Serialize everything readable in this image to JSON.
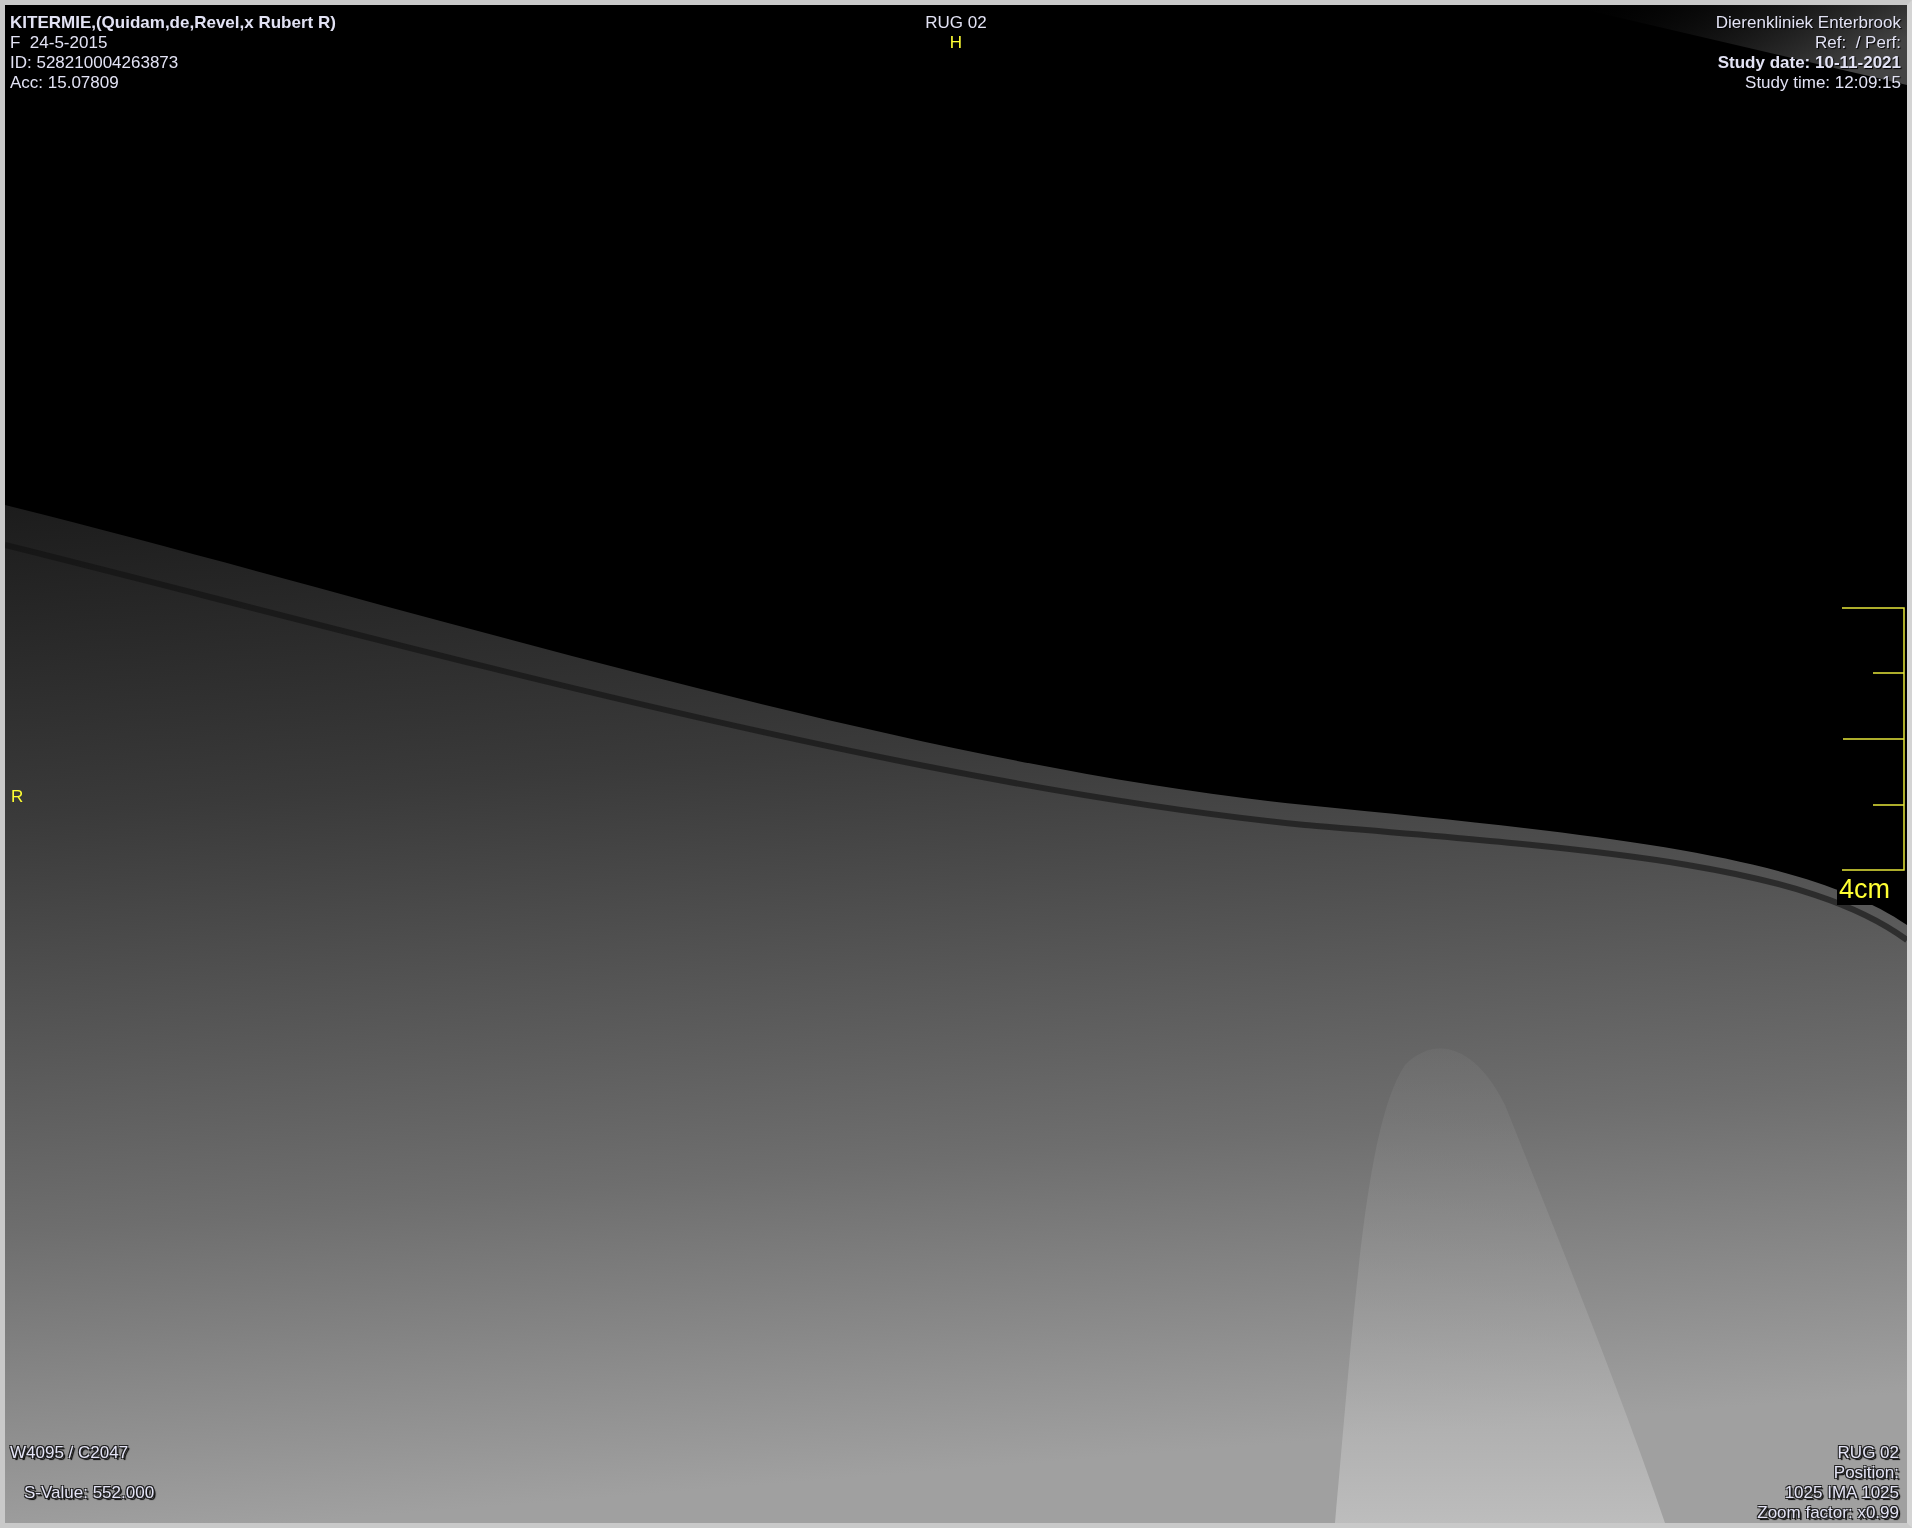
{
  "top_left": {
    "patient_name": "KITERMIE,(Quidam,de,Revel,x Rubert R)",
    "lines": [
      "F  24-5-2015",
      "ID: 528210004263873",
      "Acc: 15.07809"
    ]
  },
  "top_center": {
    "series": "RUG 02",
    "orientation": "H"
  },
  "top_right": {
    "institution": "Dierenkliniek Enterbrook",
    "ref_perf": "Ref:  / Perf:",
    "study_date": "Study date: 10-11-2021",
    "study_time": "Study time: 12:09:15"
  },
  "left_marker": "R",
  "scale": {
    "label": "4cm"
  },
  "bottom_left": {
    "window": "W4095 / C2047",
    "s_value": "S-Value: 552.000"
  },
  "bottom_right": [
    "RUG 02",
    "Position:",
    "1025 IMA 1025",
    "Zoom factor: x0.99"
  ]
}
